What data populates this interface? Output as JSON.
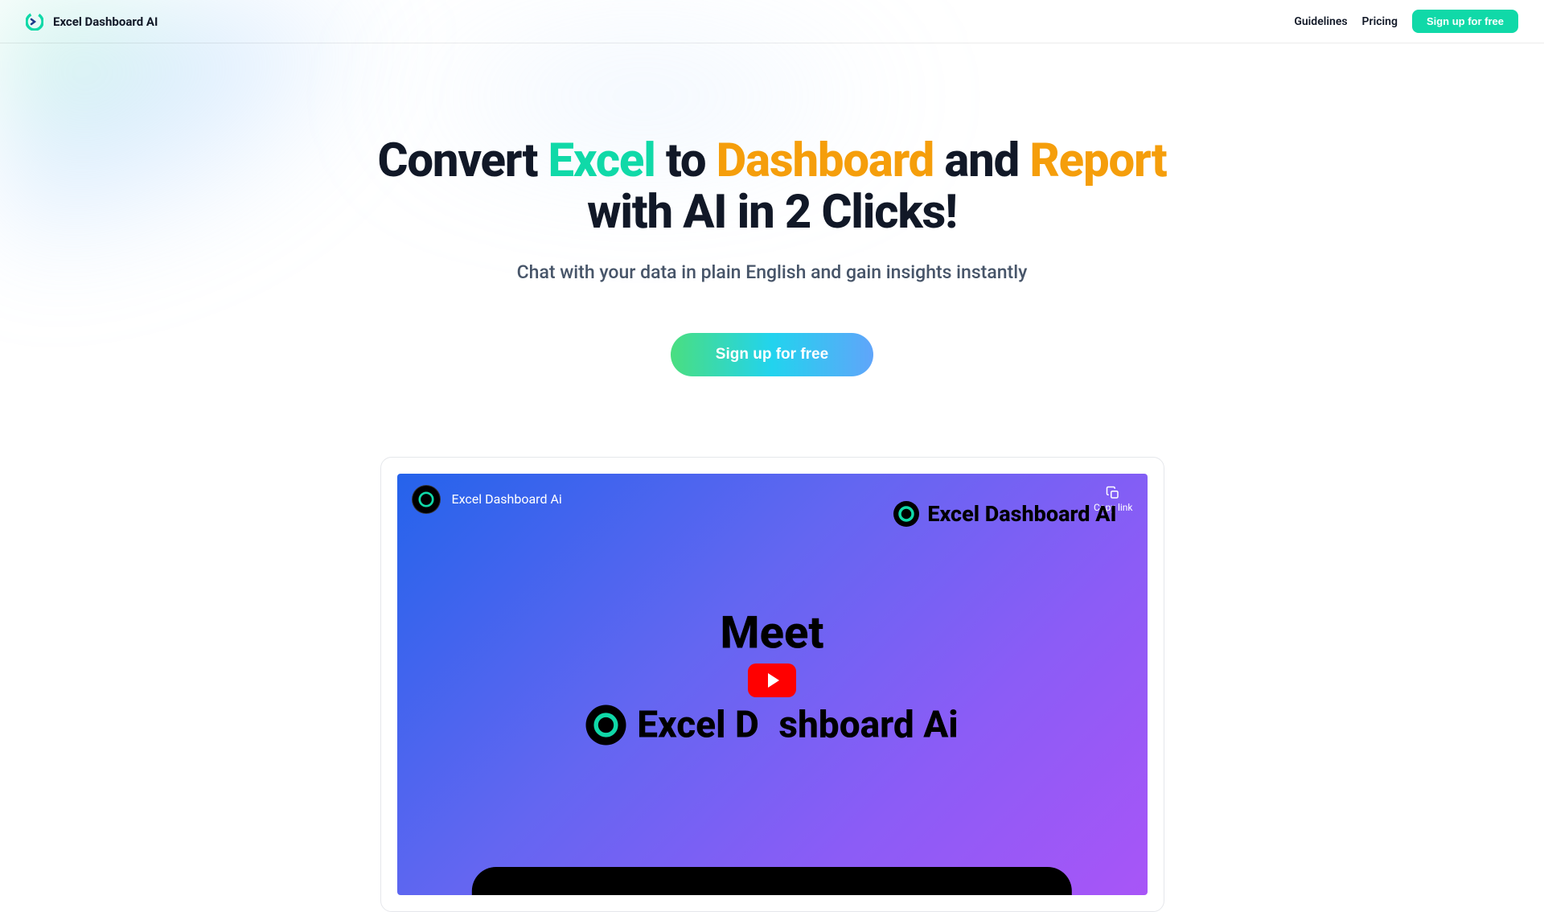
{
  "header": {
    "brand_name": "Excel Dashboard AI",
    "nav": {
      "guidelines": "Guidelines",
      "pricing": "Pricing",
      "signup": "Sign up for free"
    }
  },
  "hero": {
    "title_parts": {
      "p1": "Convert ",
      "p2": "Excel",
      "p3": " to ",
      "p4": "Dashboard",
      "p5": " and ",
      "p6": "Report",
      "p7": "with AI in 2 Clicks!"
    },
    "subtitle": "Chat with your data in plain English and gain insights instantly",
    "cta": "Sign up for free"
  },
  "video": {
    "title": "Excel Dashboard Ai",
    "copy_link": "Copy link",
    "brand_text": "Excel Dashboard AI",
    "meet_text": "Meet",
    "brand_large_p1": "Excel D",
    "brand_large_p2": "shboard Ai"
  },
  "colors": {
    "accent_green": "#10d9a8",
    "accent_orange": "#f59e0b"
  }
}
